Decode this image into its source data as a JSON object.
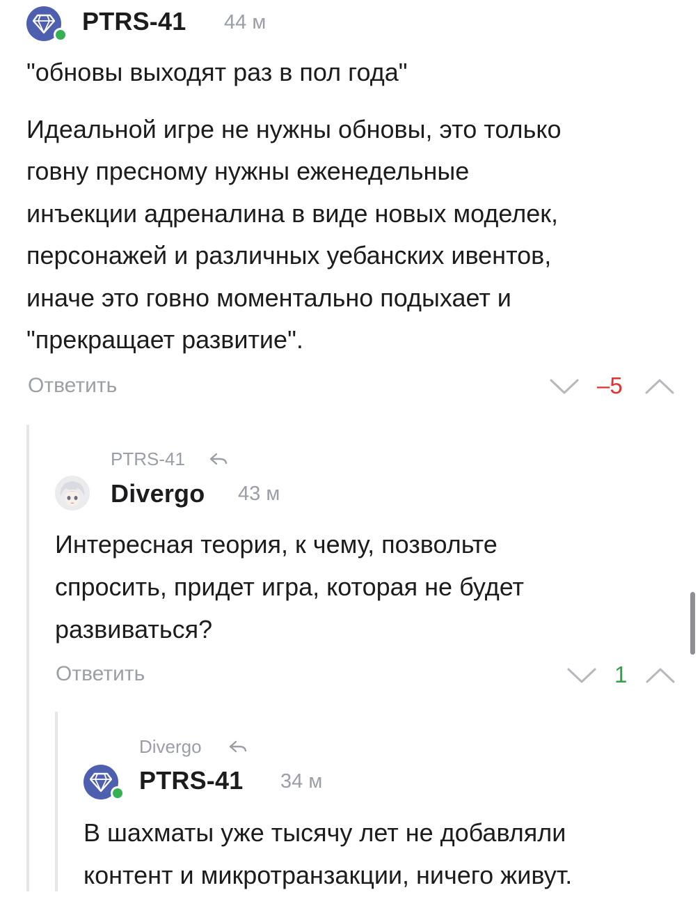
{
  "comments": [
    {
      "author": "PTRS-41",
      "time": "44 м",
      "paragraph1": "\"обновы выходят раз в пол года\"",
      "paragraph2_lines": [
        "Идеальной игре не нужны обновы, это только",
        "говну пресному нужны еженедельные",
        "инъекции адреналина в виде новых моделек,",
        "персонажей и различных уебанских ивентов,",
        "иначе это говно моментально подыхает и",
        "\"прекращает развитие\"."
      ],
      "reply_label": "Ответить",
      "score": "–5"
    },
    {
      "parent": "PTRS-41",
      "author": "Divergo",
      "time": "43 м",
      "lines": [
        "Интересная теория, к чему, позвольте",
        "спросить, придет игра, которая не будет",
        "развиваться?"
      ],
      "reply_label": "Ответить",
      "score": "1"
    },
    {
      "parent": "Divergo",
      "author": "PTRS-41",
      "time": "34 м",
      "lines": [
        "В шахматы уже тысячу лет не добавляли",
        "контент и микротранзакции, ничего живут."
      ]
    }
  ],
  "colors": {
    "avatar_bg": "#4e5fb0",
    "online": "#35b153",
    "negative_score": "#e3312f",
    "positive_score": "#2fa146"
  }
}
